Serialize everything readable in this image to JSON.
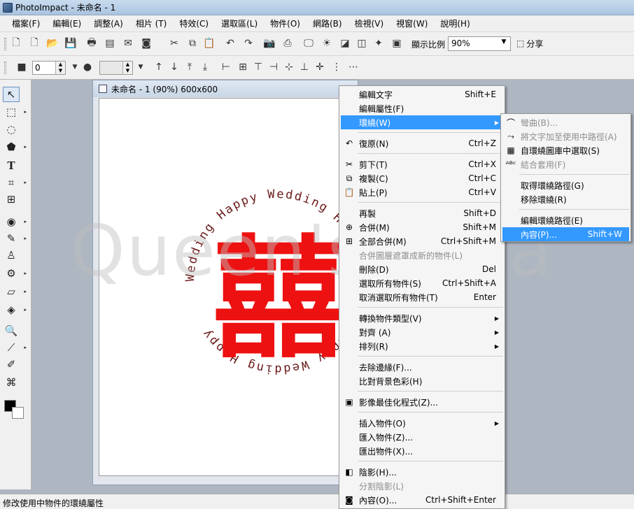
{
  "window": {
    "title": "PhotoImpact - 未命名 - 1"
  },
  "menubar": [
    "檔案(F)",
    "編輯(E)",
    "調整(A)",
    "相片 (T)",
    "特效(C)",
    "選取區(L)",
    "物件(O)",
    "網路(B)",
    "檢視(V)",
    "視窗(W)",
    "說明(H)"
  ],
  "toolbar": {
    "zoom_label": "顯示比例",
    "zoom_value": "90%",
    "share_label": "分享",
    "spin1_value": "0"
  },
  "document": {
    "title": "未命名 - 1 (90%) 600x600"
  },
  "canvas": {
    "path_text": "Wedding Happy  Wedding Happy  Wedding Happy  Wedding Happy",
    "text_color": "#6b1a1a",
    "glyph": "囍",
    "glyph_color": "#ee1111"
  },
  "watermark": "Queen's Yoka",
  "context_menu": [
    {
      "label": "編輯文字",
      "shortcut": "Shift+E",
      "icon": "",
      "state": "normal"
    },
    {
      "label": "編輯屬性(F)",
      "shortcut": "",
      "icon": "",
      "state": "normal"
    },
    {
      "label": "環繞(W)",
      "shortcut": "",
      "icon": "",
      "state": "highlighted",
      "submenu": true
    },
    {
      "sep": true
    },
    {
      "label": "復原(N)",
      "shortcut": "Ctrl+Z",
      "icon": "undo-icon",
      "state": "normal"
    },
    {
      "sep": true
    },
    {
      "label": "剪下(T)",
      "shortcut": "Ctrl+X",
      "icon": "scissors-icon",
      "state": "normal"
    },
    {
      "label": "複製(C)",
      "shortcut": "Ctrl+C",
      "icon": "copy-icon",
      "state": "normal"
    },
    {
      "label": "貼上(P)",
      "shortcut": "Ctrl+V",
      "icon": "paste-icon",
      "state": "normal"
    },
    {
      "sep": true
    },
    {
      "label": "再製",
      "shortcut": "Shift+D",
      "icon": "",
      "state": "normal"
    },
    {
      "label": "合併(M)",
      "shortcut": "Shift+M",
      "icon": "merge-icon",
      "state": "normal"
    },
    {
      "label": "全部合併(M)",
      "shortcut": "Ctrl+Shift+M",
      "icon": "merge-all-icon",
      "state": "normal"
    },
    {
      "label": "合併圖層遮罩成新的物件(L)",
      "shortcut": "",
      "icon": "",
      "state": "disabled"
    },
    {
      "label": "刪除(D)",
      "shortcut": "Del",
      "icon": "",
      "state": "normal"
    },
    {
      "label": "選取所有物件(S)",
      "shortcut": "Ctrl+Shift+A",
      "icon": "",
      "state": "normal"
    },
    {
      "label": "取消選取所有物件(T)",
      "shortcut": "Enter",
      "icon": "",
      "state": "normal"
    },
    {
      "sep": true
    },
    {
      "label": "轉換物件類型(V)",
      "shortcut": "",
      "icon": "",
      "state": "normal",
      "submenu": true
    },
    {
      "label": "對齊 (A)",
      "shortcut": "",
      "icon": "",
      "state": "normal",
      "submenu": true
    },
    {
      "label": "排列(R)",
      "shortcut": "",
      "icon": "",
      "state": "normal",
      "submenu": true
    },
    {
      "sep": true
    },
    {
      "label": "去除邊緣(F)...",
      "shortcut": "",
      "icon": "",
      "state": "normal"
    },
    {
      "label": "比對背景色彩(H)",
      "shortcut": "",
      "icon": "",
      "state": "normal"
    },
    {
      "sep": true
    },
    {
      "label": "影像最佳化程式(Z)...",
      "shortcut": "",
      "icon": "optimizer-icon",
      "state": "normal"
    },
    {
      "sep": true
    },
    {
      "label": "插入物件(O)",
      "shortcut": "",
      "icon": "",
      "state": "normal",
      "submenu": true
    },
    {
      "label": "匯入物件(Z)...",
      "shortcut": "",
      "icon": "",
      "state": "normal"
    },
    {
      "label": "匯出物件(X)...",
      "shortcut": "",
      "icon": "",
      "state": "normal"
    },
    {
      "sep": true
    },
    {
      "label": "陰影(H)...",
      "shortcut": "",
      "icon": "shadow-icon",
      "state": "normal"
    },
    {
      "label": "分割陰影(L)",
      "shortcut": "",
      "icon": "",
      "state": "disabled"
    },
    {
      "label": "內容(O)...",
      "shortcut": "Ctrl+Shift+Enter",
      "icon": "properties-icon",
      "state": "normal"
    }
  ],
  "sub_menu": [
    {
      "label": "彎曲(B)...",
      "shortcut": "",
      "icon": "bend-icon",
      "state": "disabled"
    },
    {
      "label": "將文字加至使用中路徑(A)",
      "shortcut": "",
      "icon": "text-to-path-icon",
      "state": "disabled"
    },
    {
      "label": "自環繞圖庫中選取(S)",
      "shortcut": "",
      "icon": "gallery-icon",
      "state": "normal"
    },
    {
      "label": "結合套用(F)",
      "shortcut": "",
      "icon": "combine-icon",
      "state": "disabled"
    },
    {
      "sep": true
    },
    {
      "label": "取得環繞路徑(G)",
      "shortcut": "",
      "icon": "",
      "state": "normal"
    },
    {
      "label": "移除環繞(R)",
      "shortcut": "",
      "icon": "",
      "state": "normal"
    },
    {
      "sep": true
    },
    {
      "label": "編輯環繞路徑(E)",
      "shortcut": "",
      "icon": "",
      "state": "normal"
    },
    {
      "label": "內容(P)...",
      "shortcut": "Shift+W",
      "icon": "",
      "state": "highlighted"
    }
  ],
  "statusbar": {
    "text": "修改使用中物件的環繞屬性"
  }
}
